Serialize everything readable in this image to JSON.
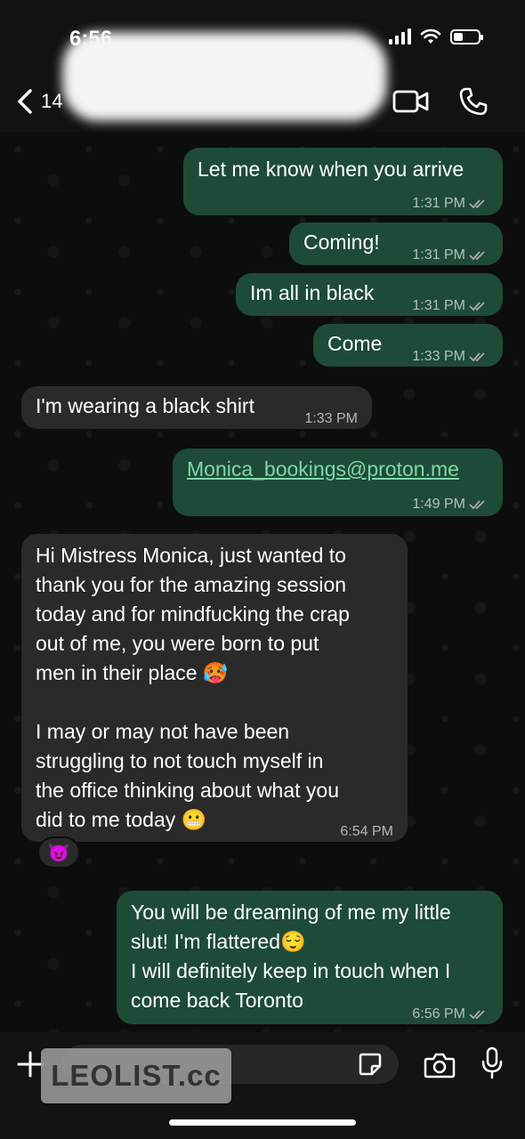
{
  "status": {
    "time": "6:56",
    "battery_level": 0.4
  },
  "header": {
    "back_label": "14",
    "video_icon": "video-camera-icon",
    "call_icon": "phone-icon"
  },
  "messages": [
    {
      "dir": "out",
      "text": "Let me know when you arrive",
      "time": "1:31 PM"
    },
    {
      "dir": "out",
      "text": "Coming!",
      "time": "1:31 PM"
    },
    {
      "dir": "out",
      "text": "Im all in black",
      "time": "1:31 PM"
    },
    {
      "dir": "out",
      "text": "Come",
      "time": "1:33 PM"
    },
    {
      "dir": "in",
      "text": "I'm wearing a black shirt",
      "time": "1:33 PM"
    },
    {
      "dir": "out",
      "text": "Monica_bookings@proton.me",
      "time": "1:49 PM"
    },
    {
      "dir": "in",
      "text": "Hi Mistress Monica, just wanted to\nthank you for the amazing session\ntoday and for mindfucking the crap\nout of me, you were born to put\nmen in their place 🥵\n\nI may or may not have been\nstruggling to not touch myself in\nthe office thinking about what you\ndid to me today 😬",
      "time": "6:54 PM",
      "reaction": "😈"
    },
    {
      "dir": "out",
      "text": "You will be dreaming of me my little\nslut! I'm flattered😌\nI will definitely keep in touch when I\ncome back Toronto",
      "time": "6:56 PM"
    }
  ],
  "composer": {
    "watermark": "LEOLIST.cc"
  },
  "colors": {
    "outgoing": "#1e4b38",
    "incoming": "#2a2a2a",
    "background": "#0d0d0d"
  }
}
